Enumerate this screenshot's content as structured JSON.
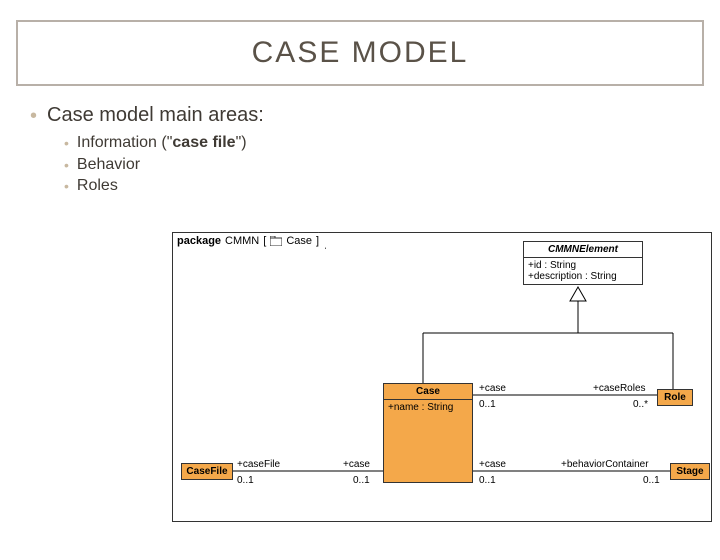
{
  "title": "CASE MODEL",
  "mainBullet": "Case model main areas:",
  "subs": {
    "info_pre": "Information (\"",
    "info_bold": "case file",
    "info_post": "\")",
    "behavior": "Behavior",
    "roles": "Roles"
  },
  "diagram": {
    "pkg_label_prefix": "package",
    "pkg_name": "CMMN",
    "pkg_view": "Case",
    "classes": {
      "cmmn_element": {
        "name": "CMMNElement",
        "attrs": [
          "+id : String",
          "+description : String"
        ]
      },
      "case": {
        "name": "Case",
        "attrs": [
          "+name : String"
        ]
      },
      "role": {
        "name": "Role"
      },
      "casefile": {
        "name": "CaseFile"
      },
      "stage": {
        "name": "Stage"
      }
    },
    "assoc": {
      "case_role_end1": "+case",
      "case_role_end2": "+caseRoles",
      "case_role_m1": "0..1",
      "case_role_m2": "0..*",
      "case_casefile_end1": "+caseFile",
      "case_casefile_end2": "+case",
      "case_casefile_m1": "0..1",
      "case_casefile_m2": "0..1",
      "case_stage_end1": "+case",
      "case_stage_end2": "+behaviorContainer",
      "case_stage_m1": "0..1",
      "case_stage_m2": "0..1"
    }
  }
}
